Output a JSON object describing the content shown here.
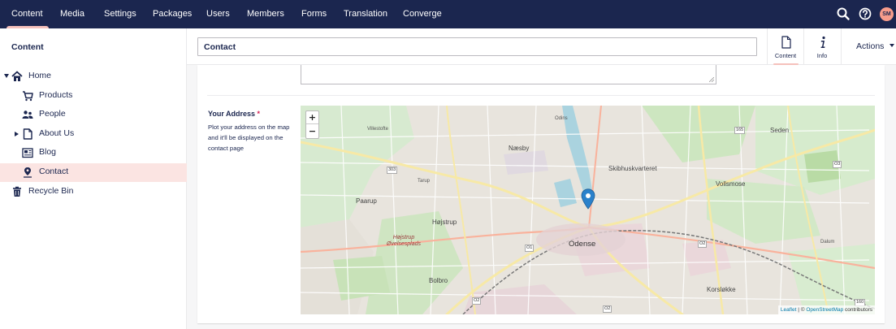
{
  "nav": {
    "items": [
      "Content",
      "Media",
      "Settings",
      "Packages",
      "Users",
      "Members",
      "Forms",
      "Translation",
      "Converge"
    ],
    "active": "Content",
    "user_initials": "SM"
  },
  "sidebar": {
    "title": "Content",
    "items": [
      {
        "label": "Home",
        "icon": "home-icon"
      },
      {
        "label": "Products",
        "icon": "shopping-cart-icon"
      },
      {
        "label": "People",
        "icon": "people-icon"
      },
      {
        "label": "About Us",
        "icon": "document-icon"
      },
      {
        "label": "Blog",
        "icon": "newspaper-icon"
      },
      {
        "label": "Contact",
        "icon": "map-pin-icon"
      },
      {
        "label": "Recycle Bin",
        "icon": "trash-icon"
      }
    ],
    "selected": "Contact"
  },
  "editor": {
    "name_value": "Contact",
    "apps": [
      {
        "label": "Content",
        "icon": "document-icon"
      },
      {
        "label": "Info",
        "icon": "info-icon"
      }
    ],
    "actions_label": "Actions"
  },
  "field": {
    "label": "Your Address",
    "required_mark": "*",
    "description": "Plot your address on the map and it'll be displayed on the contact page"
  },
  "map": {
    "zoom_in": "+",
    "zoom_out": "−",
    "places": [
      "Odense",
      "Næsby",
      "Skibhuskvarteret",
      "Vollsmose",
      "Seden",
      "Paarup",
      "Højstrup",
      "Højstrup Øvelsesplads",
      "Tarup",
      "Villestofte",
      "Bolbro",
      "Korsløkke",
      "Odins",
      "Dalum"
    ],
    "road_labels": [
      "303",
      "165",
      "O3",
      "O1",
      "O2",
      "O2",
      "O2",
      "160"
    ],
    "attribution_link1": "Leaflet",
    "attribution_sep": " | © ",
    "attribution_link2": "OpenStreetMap",
    "attribution_tail": " contributors"
  },
  "colors": {
    "nav_bg": "#1b264f",
    "accent": "#f5c1bc",
    "selected_bg": "#fbe4e2",
    "required": "#d42054",
    "pin": "#2a81cb"
  }
}
